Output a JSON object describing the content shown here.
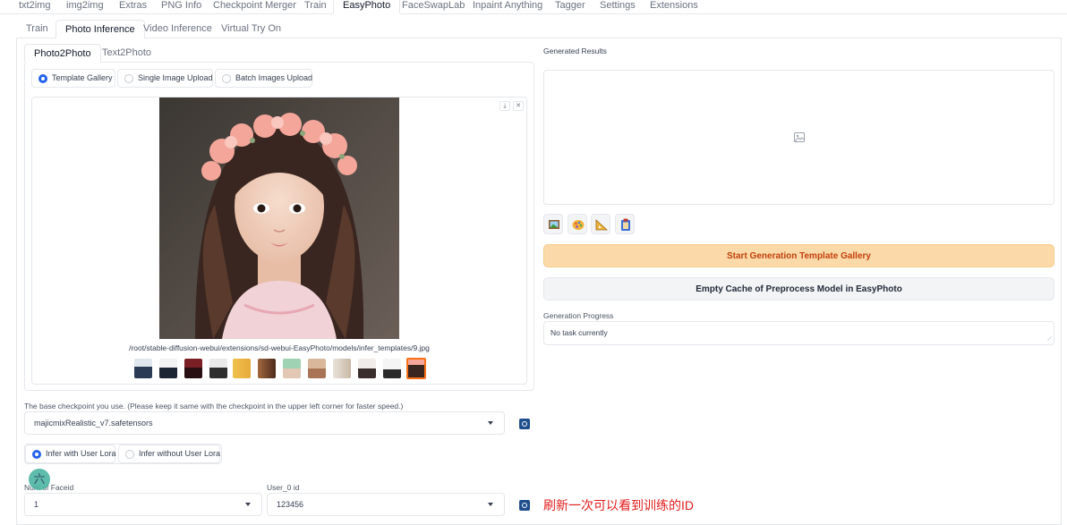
{
  "top_tabs": [
    "txt2img",
    "img2img",
    "Extras",
    "PNG Info",
    "Checkpoint Merger",
    "Train",
    "EasyPhoto",
    "FaceSwapLab",
    "Inpaint Anything",
    "Tagger",
    "Settings",
    "Extensions"
  ],
  "easyphoto_tabs": [
    "Train",
    "Photo Inference",
    "Video Inference",
    "Virtual Try On"
  ],
  "mode_tabs": [
    "Photo2Photo",
    "Text2Photo"
  ],
  "upload_options": [
    "Template Gallery",
    "Single Image Upload",
    "Batch Images Upload"
  ],
  "gallery": {
    "caption": "/root/stable-diffusion-webui/extensions/sd-webui-EasyPhoto/models/infer_templates/9.jpg",
    "download_icon": "download-icon",
    "close_icon": "close-icon",
    "thumbnail_count": 12,
    "selected_index": 11
  },
  "checkpoint": {
    "label": "The base checkpoint you use. (Please keep it same with the checkpoint in the upper left corner for faster speed.)",
    "value": "majicmixRealistic_v7.safetensors"
  },
  "lora_options": [
    "Infer with User Lora",
    "Infer without User Lora"
  ],
  "faceid": {
    "num_label": "Num of Faceid",
    "num_value": "1",
    "user_label": "User_0 id",
    "user_value": "123456"
  },
  "floating_avatar_text": "六",
  "annotation_text": "刷新一次可以看到训练的ID",
  "results": {
    "label": "Generated Results",
    "empty_icon": "image-icon"
  },
  "tool_icons": [
    "picture-icon",
    "palette-icon",
    "ruler-icon",
    "clipboard-icon"
  ],
  "buttons": {
    "start": "Start Generation Template Gallery",
    "empty_cache": "Empty Cache of Preprocess Model in EasyPhoto"
  },
  "progress": {
    "label": "Generation Progress",
    "value": "No task currently"
  },
  "colors": {
    "accent_blue": "#2563eb",
    "start_button": "#fbd9a8",
    "start_text": "#c2410c",
    "annotation": "#e11d1d"
  }
}
